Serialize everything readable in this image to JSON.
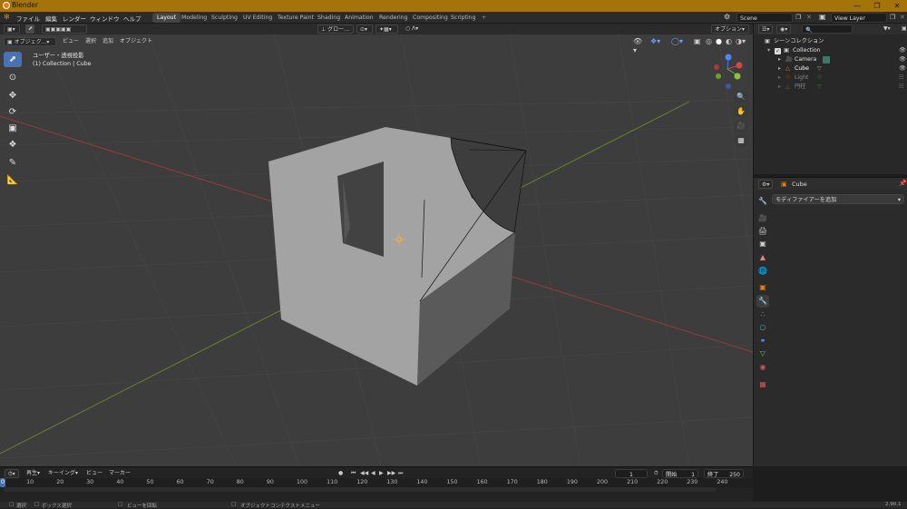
{
  "window": {
    "title": "Blender"
  },
  "menu": [
    "ファイル",
    "編集",
    "レンダー",
    "ウィンドウ",
    "ヘルプ"
  ],
  "workspaces": [
    "Layout",
    "Modeling",
    "Sculpting",
    "UV Editing",
    "Texture Paint",
    "Shading",
    "Animation",
    "Rendering",
    "Compositing",
    "Scripting"
  ],
  "active_workspace": "Layout",
  "scene": {
    "name": "Scene",
    "view_layer": "View Layer"
  },
  "viewport": {
    "mode": "オブジェク...",
    "menus": [
      "ビュー",
      "選択",
      "追加",
      "オブジェクト"
    ],
    "transform": "グロー...",
    "options": "オプション",
    "info_line1": "ユーザー・透視投影",
    "info_line2": "(1) Collection | Cube"
  },
  "gizmo": {
    "x": "X",
    "y": "Y",
    "z": "Z"
  },
  "outliner": {
    "title": "シーンコレクション",
    "items": [
      {
        "name": "Collection",
        "type": "collection"
      },
      {
        "name": "Camera",
        "type": "camera"
      },
      {
        "name": "Cube",
        "type": "mesh"
      },
      {
        "name": "Light",
        "type": "light"
      },
      {
        "name": "円柱",
        "type": "mesh"
      }
    ]
  },
  "properties": {
    "object": "Cube",
    "add_modifier": "モディファイアーを追加"
  },
  "timeline": {
    "menus": [
      "再生",
      "キーイング",
      "ビュー",
      "マーカー"
    ],
    "current_frame": "1",
    "start_label": "開始",
    "start": "1",
    "end_label": "終了",
    "end": "250",
    "ticks": [
      "0",
      "10",
      "20",
      "30",
      "40",
      "50",
      "60",
      "70",
      "80",
      "90",
      "100",
      "110",
      "120",
      "130",
      "140",
      "150",
      "160",
      "170",
      "180",
      "190",
      "200",
      "210",
      "220",
      "230",
      "240"
    ]
  },
  "statusbar": {
    "left": "選択",
    "middle1": "ボックス選択",
    "middle2": "ビューを回転",
    "right": "オブジェクトコンテクストメニュー",
    "version": "2.90.1"
  },
  "colors": {
    "accent": "#4772b3",
    "orange": "#e87d0d",
    "titlebar": "#a4740a"
  }
}
